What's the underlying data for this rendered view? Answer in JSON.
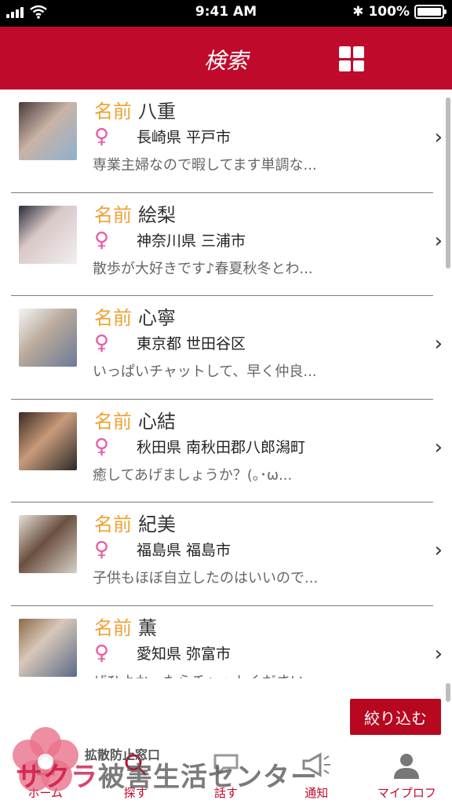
{
  "status": {
    "time": "9:41 AM",
    "battery": "100%",
    "battery_level": 1.0
  },
  "header": {
    "title": "検索"
  },
  "name_label": "名前",
  "gender_symbol": "♀",
  "colors": {
    "brand": "#c00a2b",
    "name_label": "#f0a030",
    "gender": "#e85aa8"
  },
  "profiles": [
    {
      "name": "八重",
      "location": "長崎県 平戸市",
      "message": "専業主婦なので暇してます単調な..."
    },
    {
      "name": "絵梨",
      "location": "神奈川県 三浦市",
      "message": "散歩が大好きです♪春夏秋冬とわ..."
    },
    {
      "name": "心寧",
      "location": "東京都 世田谷区",
      "message": "いっぱいチャットして、早く仲良..."
    },
    {
      "name": "心結",
      "location": "秋田県 南秋田郡八郎潟町",
      "message": "癒してあげましょうか？(｡･ω..."
    },
    {
      "name": "紀美",
      "location": "福島県 福島市",
      "message": "子供もほぼ自立したのはいいので..."
    },
    {
      "name": "薫",
      "location": "愛知県 弥富市",
      "message": "ぜひよかったらチャットください"
    }
  ],
  "filter_button": "絞り込む",
  "tabs": [
    {
      "label": "ホーム",
      "icon": "home-icon"
    },
    {
      "label": "探す",
      "icon": "search-icon"
    },
    {
      "label": "話す",
      "icon": "chat-icon"
    },
    {
      "label": "通知",
      "icon": "megaphone-icon"
    },
    {
      "label": "マイプロフ",
      "icon": "person-icon"
    }
  ],
  "watermark": {
    "sub": "拡散防止窓口",
    "main_a": "サクラ",
    "main_b": "被害生活センター"
  }
}
